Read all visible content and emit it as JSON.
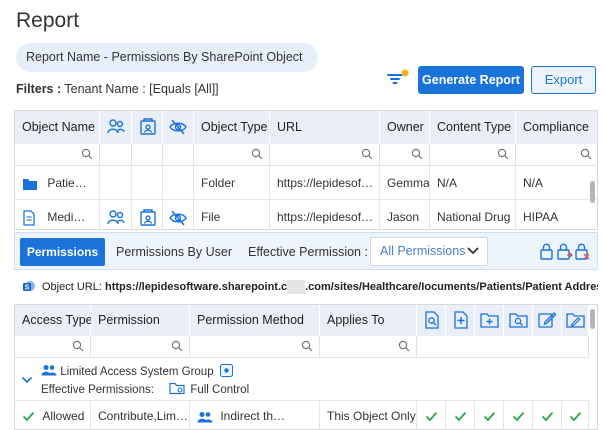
{
  "page": {
    "title": "Report"
  },
  "report": {
    "name_label": "Report Name - Permissions By SharePoint Object"
  },
  "filters": {
    "label": "Filters :",
    "value": "Tenant Name : [Equals [All]]"
  },
  "toolbar": {
    "generate_label": "Generate Report",
    "export_label": "Export"
  },
  "grid": {
    "headers": {
      "object_name": "Object Name",
      "object_type": "Object Type",
      "url": "URL",
      "owner": "Owner",
      "content_type": "Content Type",
      "compliance": "Compliance"
    },
    "rows": [
      {
        "icon": "folder-icon",
        "name": "Patie…",
        "object_type": "Folder",
        "url": "https://lepidesof…",
        "owner": "Gemma",
        "content_type": "N/A",
        "compliance": "N/A"
      },
      {
        "icon": "document-icon",
        "name": "Medi…",
        "object_type": "File",
        "url": "https://lepidesof…",
        "owner": "Jason",
        "content_type": "National Drug",
        "compliance": "HIPAA"
      }
    ]
  },
  "permissions_panel": {
    "tabs": [
      {
        "label": "Permissions"
      },
      {
        "label": "Permissions By User"
      }
    ],
    "effective_label": "Effective Permission :",
    "effective_value": "All Permissions",
    "object_url_label": "Object URL:",
    "object_url_start": "https://lepidesoftware.sharepoint.c",
    "object_url_end": ".com/sites/Healthcare/Iocuments/Patients/Patient Address.Docx",
    "headers": {
      "access_type": "Access Type",
      "permission": "Permission",
      "permission_method": "Permission Method",
      "applies_to": "Applies To"
    },
    "group": {
      "name": "Limited Access System Group",
      "effective_label": "Effective Permissions:",
      "effective_value": "Full Control"
    },
    "row": {
      "access_type": "Allowed",
      "permission": "Contribute,Lim…",
      "method": "Indirect th…",
      "applies_to": "This Object Only"
    }
  },
  "colors": {
    "accent": "#1a73d9",
    "header_bg": "#e9eef7",
    "check": "#2ea44f",
    "danger": "#d9534f"
  }
}
